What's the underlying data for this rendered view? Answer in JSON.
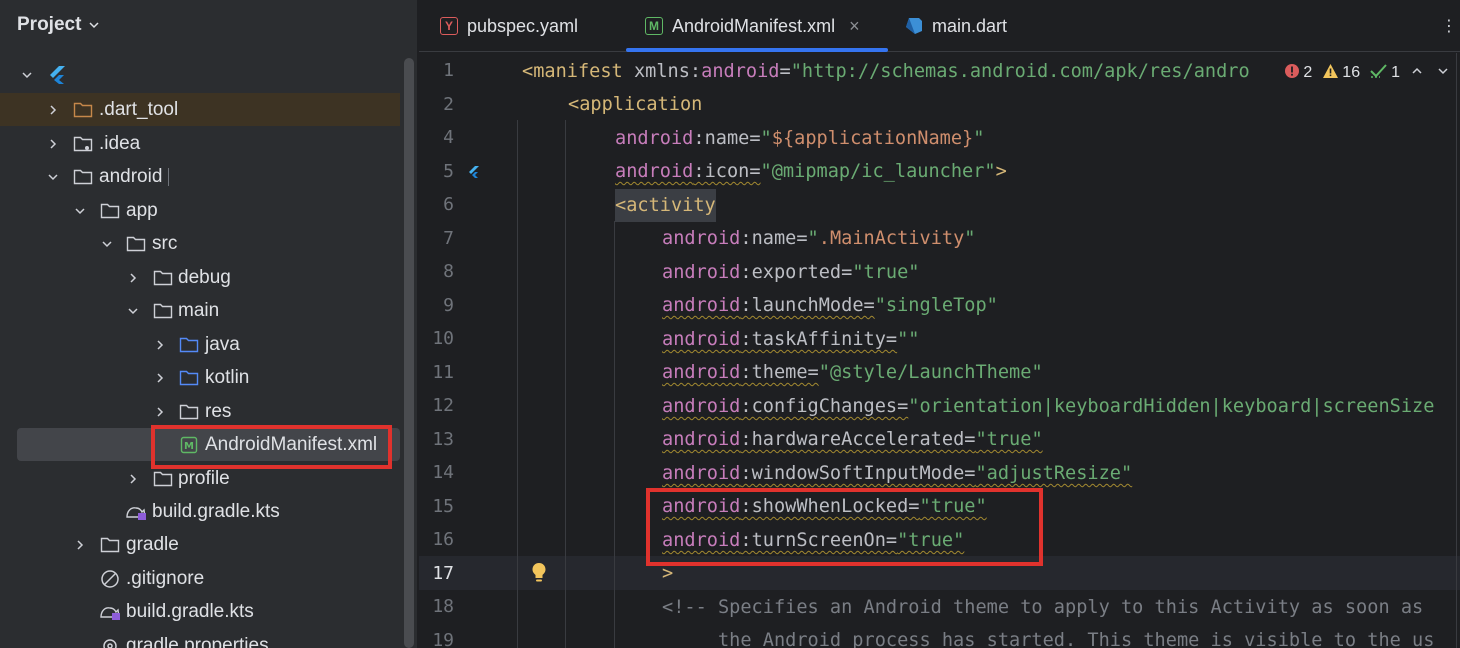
{
  "project_panel": {
    "title": "Project",
    "tree": [
      {
        "label": "",
        "icon": "flutter-icon",
        "expanded": true
      },
      {
        "label": ".dart_tool",
        "icon": "folder-icon",
        "expanded": false
      },
      {
        "label": ".idea",
        "icon": "folder-icon",
        "expanded": false
      },
      {
        "label": "android",
        "icon": "folder-icon",
        "expanded": true
      },
      {
        "label": "app",
        "icon": "folder-icon",
        "expanded": true
      },
      {
        "label": "src",
        "icon": "folder-icon",
        "expanded": true
      },
      {
        "label": "debug",
        "icon": "folder-icon",
        "expanded": false
      },
      {
        "label": "main",
        "icon": "folder-icon",
        "expanded": true
      },
      {
        "label": "java",
        "icon": "source-folder-icon",
        "expanded": false
      },
      {
        "label": "kotlin",
        "icon": "source-folder-icon",
        "expanded": false
      },
      {
        "label": "res",
        "icon": "folder-icon",
        "expanded": false
      },
      {
        "label": "AndroidManifest.xml",
        "icon": "manifest-file-icon",
        "selected": true
      },
      {
        "label": "profile",
        "icon": "folder-icon",
        "expanded": false
      },
      {
        "label": "build.gradle.kts",
        "icon": "gradle-kts-icon"
      },
      {
        "label": "gradle",
        "icon": "folder-icon",
        "expanded": false
      },
      {
        "label": ".gitignore",
        "icon": "gitignore-icon"
      },
      {
        "label": "build.gradle.kts",
        "icon": "gradle-kts-icon"
      },
      {
        "label": "gradle.properties",
        "icon": "settings-file-icon"
      }
    ]
  },
  "tabs": [
    {
      "label": "pubspec.yaml",
      "icon": "yaml-icon",
      "active": false
    },
    {
      "label": "AndroidManifest.xml",
      "icon": "manifest-file-icon",
      "active": true
    },
    {
      "label": "main.dart",
      "icon": "dart-icon",
      "active": false
    }
  ],
  "inspections": {
    "errors": "2",
    "warnings": "16",
    "weak_warnings": "1"
  },
  "editor": {
    "current_line": "17",
    "lines": [
      {
        "num": "1"
      },
      {
        "num": "2"
      },
      {
        "num": "4"
      },
      {
        "num": "5"
      },
      {
        "num": "6"
      },
      {
        "num": "7"
      },
      {
        "num": "8"
      },
      {
        "num": "9"
      },
      {
        "num": "10"
      },
      {
        "num": "11"
      },
      {
        "num": "12"
      },
      {
        "num": "13"
      },
      {
        "num": "14"
      },
      {
        "num": "15"
      },
      {
        "num": "16"
      },
      {
        "num": "17"
      },
      {
        "num": "18"
      },
      {
        "num": "19"
      }
    ],
    "code": {
      "l1_tag": "<manifest",
      "l1_attr": " xmlns:",
      "l1_ns": "android",
      "l1_eq": "=",
      "l1_val": "\"http://schemas.android.com/apk/res/andro",
      "l2": "<application",
      "l4_ns": "android",
      "l4_attr": ":name=",
      "l4_q1": "\"",
      "l4_ph": "${applicationName}",
      "l4_q2": "\"",
      "l5_ns": "android",
      "l5_attr": ":icon=",
      "l5_val": "\"@mipmap/ic_launcher\"",
      "l5_end": ">",
      "l6": "<activity",
      "l7_ns": "android",
      "l7_attr": ":name=",
      "l7_q1": "\"",
      "l7_cls": ".MainActivity",
      "l7_q2": "\"",
      "l8_ns": "android",
      "l8_attr": ":exported=",
      "l8_val": "\"true\"",
      "l9_ns": "android",
      "l9_attr": ":launchMode=",
      "l9_val": "\"singleTop\"",
      "l10_ns": "android",
      "l10_attr": ":taskAffinity=",
      "l10_val": "\"\"",
      "l11_ns": "android",
      "l11_attr": ":theme=",
      "l11_val": "\"@style/LaunchTheme\"",
      "l12_ns": "android",
      "l12_attr": ":configChanges=",
      "l12_val": "\"orientation|keyboardHidden|keyboard|screenSize",
      "l13_ns": "android",
      "l13_attr": ":hardwareAccelerated=",
      "l13_val": "\"true\"",
      "l14_ns": "android",
      "l14_attr": ":windowSoftInputMode=",
      "l14_val": "\"adjustResize\"",
      "l15_ns": "android",
      "l15_attr": ":showWhenLocked=",
      "l15_val": "\"true\"",
      "l16_ns": "android",
      "l16_attr": ":turnScreenOn=",
      "l16_val": "\"true\"",
      "l17": ">",
      "l18": "<!-- Specifies an Android theme to apply to this Activity as soon as",
      "l19": "     the Android process has started. This theme is visible to the us"
    }
  },
  "colors": {
    "highlight_box": "#e0322d",
    "accent": "#3574f0"
  }
}
